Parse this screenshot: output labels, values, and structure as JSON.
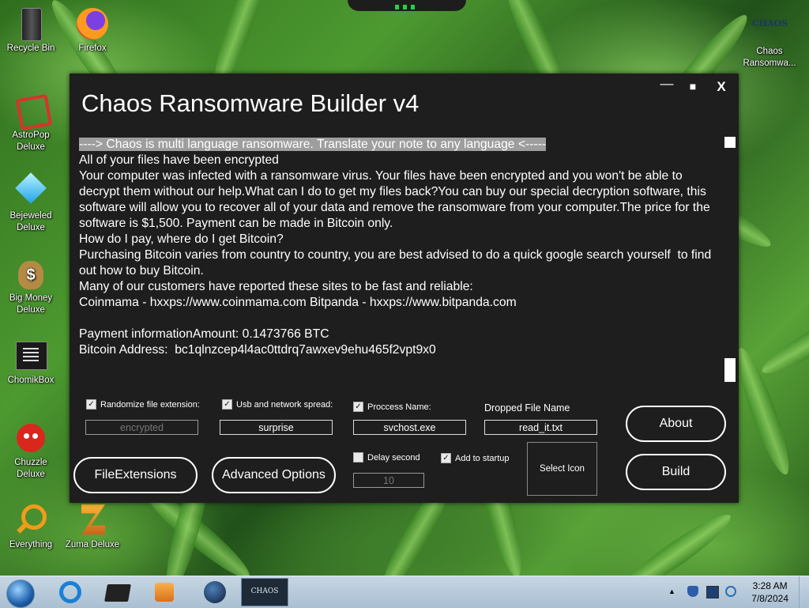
{
  "desktop": {
    "icons": [
      {
        "label_lines": [
          "Recycle Bin"
        ]
      },
      {
        "label_lines": [
          "Firefox"
        ]
      },
      {
        "label_lines": [
          "AstroPop",
          "Deluxe"
        ]
      },
      {
        "label_lines": [
          "Bejeweled",
          "Deluxe"
        ]
      },
      {
        "label_lines": [
          "Big Money",
          "Deluxe"
        ]
      },
      {
        "label_lines": [
          "ChomikBox"
        ]
      },
      {
        "label_lines": [
          "Chuzzle",
          "Deluxe"
        ]
      },
      {
        "label_lines": [
          "Everything"
        ]
      },
      {
        "label_lines": [
          "Zuma Deluxe"
        ]
      },
      {
        "label_lines": [
          "Chaos",
          "Ransomwa..."
        ]
      }
    ],
    "chaos_icon_text": "CHAOS"
  },
  "window": {
    "title": "Chaos Ransomware Builder v4",
    "controls": {
      "minimize": "—",
      "maximize": "■",
      "close": "X"
    },
    "note": {
      "highlight_line": "----> Chaos is multi language ransomware. Translate your note to any language <-----",
      "body": "All of your files have been encrypted\nYour computer was infected with a ransomware virus. Your files have been encrypted and you won't be able to decrypt them without our help.What can I do to get my files back?You can buy our special decryption software, this software will allow you to recover all of your data and remove the ransomware from your computer.The price for the software is $1,500. Payment can be made in Bitcoin only.\nHow do I pay, where do I get Bitcoin?\nPurchasing Bitcoin varies from country to country, you are best advised to do a quick google search yourself  to find out how to buy Bitcoin.\nMany of our customers have reported these sites to be fast and reliable:\nCoinmama - hxxps://www.coinmama.com Bitpanda - hxxps://www.bitpanda.com\n\nPayment informationAmount: 0.1473766 BTC\nBitcoin Address:  bc1qlnzcep4l4ac0ttdrq7awxev9ehu465f2vpt9x0"
    },
    "options": {
      "randomize_ext": {
        "label": "Randomize file extension:",
        "checked": true,
        "value": "encrypted"
      },
      "usb_spread": {
        "label": "Usb and network spread:",
        "checked": true,
        "value": "surprise"
      },
      "process_name": {
        "label": "Proccess Name:",
        "checked": true,
        "value": "svchost.exe"
      },
      "dropped_file": {
        "label": "Dropped File Name",
        "value": "read_it.txt"
      },
      "delay": {
        "label": "Delay second",
        "checked": false,
        "value": "10"
      },
      "startup": {
        "label": "Add to startup",
        "checked": true
      }
    },
    "buttons": {
      "file_extensions": "FileExtensions",
      "advanced_options": "Advanced Options",
      "select_icon": "Select Icon",
      "about": "About",
      "build": "Build"
    }
  },
  "taskbar": {
    "chaos_task_label": "CHAOS",
    "time": "3:28 AM",
    "date": "7/8/2024"
  }
}
